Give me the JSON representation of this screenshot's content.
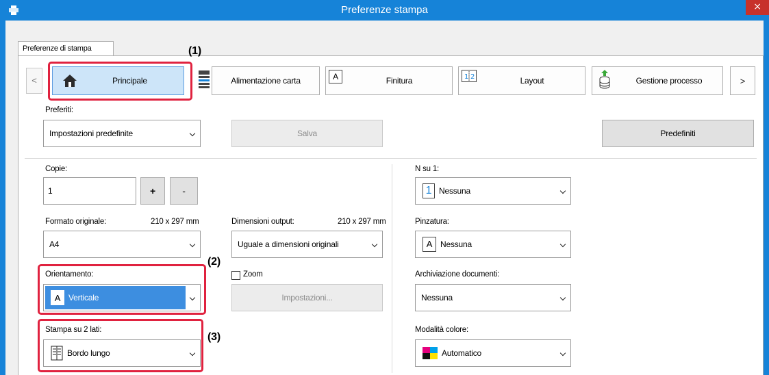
{
  "window": {
    "title": "Preferenze stampa",
    "close_glyph": "×"
  },
  "tab": {
    "label": "Preferenze di stampa"
  },
  "nav": {
    "prev": "<",
    "next": ">",
    "items": [
      {
        "label": "Principale",
        "icon": "home-icon"
      },
      {
        "label": "Alimentazione carta",
        "icon": "paper-tray-icon"
      },
      {
        "label": "Finitura",
        "icon": "finishing-icon"
      },
      {
        "label": "Layout",
        "icon": "layout-icon"
      },
      {
        "label": "Gestione processo",
        "icon": "job-handling-icon"
      }
    ]
  },
  "favorites": {
    "label": "Preferiti:",
    "value": "Impostazioni predefinite",
    "save": "Salva",
    "defaults": "Predefiniti"
  },
  "copies": {
    "label": "Copie:",
    "value": "1",
    "plus": "+",
    "minus": "-"
  },
  "original_size": {
    "label": "Formato originale:",
    "dims": "210 x 297 mm",
    "value": "A4"
  },
  "output_size": {
    "label": "Dimensioni output:",
    "dims": "210 x 297 mm",
    "value": "Uguale a dimensioni originali"
  },
  "orientation": {
    "label": "Orientamento:",
    "value": "Verticale",
    "icon_letter": "A"
  },
  "zoom": {
    "label": "Zoom",
    "settings": "Impostazioni..."
  },
  "duplex": {
    "label": "Stampa su 2 lati:",
    "value": "Bordo lungo"
  },
  "nup": {
    "label": "N su 1:",
    "value": "Nessuna",
    "icon_digit": "1"
  },
  "stapling": {
    "label": "Pinzatura:",
    "value": "Nessuna",
    "icon_letter": "A"
  },
  "doc_filing": {
    "label": "Archiviazione documenti:",
    "value": "Nessuna"
  },
  "color_mode": {
    "label": "Modalità colore:",
    "value": "Automatico"
  },
  "callouts": {
    "c1": "(1)",
    "c2": "(2)",
    "c3": "(3)"
  },
  "colors": {
    "titlebar": "#1683d8",
    "close": "#c7312b",
    "highlight": "#e0223f",
    "selected": "#3d8ee0"
  }
}
